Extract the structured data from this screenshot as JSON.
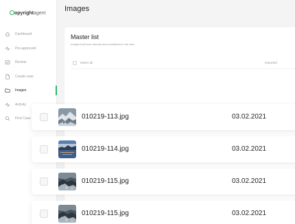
{
  "app": {
    "logo_bold": "opyright",
    "logo_light": "agent"
  },
  "sidebar": {
    "items": [
      {
        "label": "Dashboard",
        "icon": "home-icon",
        "active": false
      },
      {
        "label": "Pre-approved",
        "icon": "activity-icon",
        "active": false
      },
      {
        "label": "Review",
        "icon": "review-icon",
        "active": false
      },
      {
        "label": "Create case",
        "icon": "document-icon",
        "active": false
      },
      {
        "label": "Images",
        "icon": "folder-icon",
        "active": true
      },
      {
        "label": "Activity",
        "icon": "activity-icon",
        "active": false
      },
      {
        "label": "Find Case",
        "icon": "search-icon",
        "active": false
      }
    ]
  },
  "page": {
    "title": "Images"
  },
  "master_list": {
    "title": "Master list",
    "subtitle": "Images that have already been published to the web.",
    "select_all_label": "Select all",
    "imported_header": "Imported"
  },
  "rows": [
    {
      "filename": "010219-113.jpg",
      "date": "03.02.2021",
      "thumb": "snow-mountain-thumbnail"
    },
    {
      "filename": "010219-114.jpg",
      "date": "03.02.2021",
      "thumb": "lake-sunset-thumbnail"
    },
    {
      "filename": "010219-115.jpg",
      "date": "03.02.2021",
      "thumb": "rocky-shore-thumbnail"
    },
    {
      "filename": "010219-115.jpg",
      "date": "03.02.2021",
      "thumb": "rocky-shore-thumbnail"
    }
  ],
  "colors": {
    "accent": "#2db36f",
    "background": "#f4f4f5",
    "surface": "#ffffff",
    "muted_text": "#9a9a9a"
  }
}
